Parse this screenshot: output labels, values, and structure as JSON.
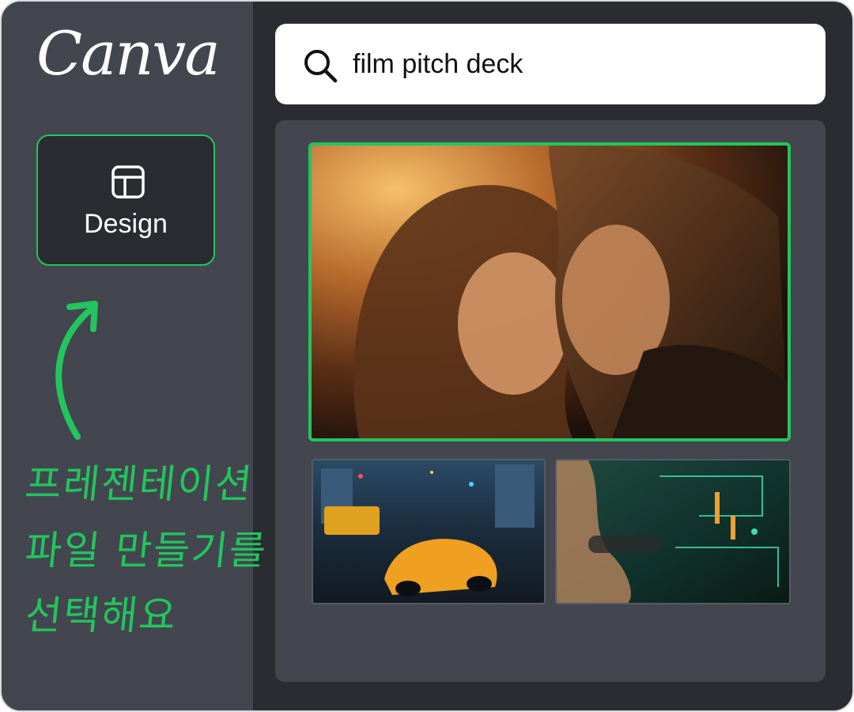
{
  "brand": {
    "logo_text": "Canva",
    "accent_color": "#22c55e"
  },
  "sidebar": {
    "design_button": {
      "label": "Design",
      "icon": "layout-template-icon"
    }
  },
  "annotation": {
    "lines": [
      "프레젠테이션",
      "파일 만들기를",
      "선택해요"
    ],
    "color": "#22c55e",
    "icon": "curved-arrow-up-icon"
  },
  "search": {
    "value": "film pitch deck",
    "icon": "search-icon"
  },
  "results": {
    "items": [
      {
        "name": "result-thumbnail-romance",
        "selected": true
      },
      {
        "name": "result-thumbnail-car-chase",
        "selected": false
      },
      {
        "name": "result-thumbnail-cyber-face",
        "selected": false
      }
    ]
  }
}
